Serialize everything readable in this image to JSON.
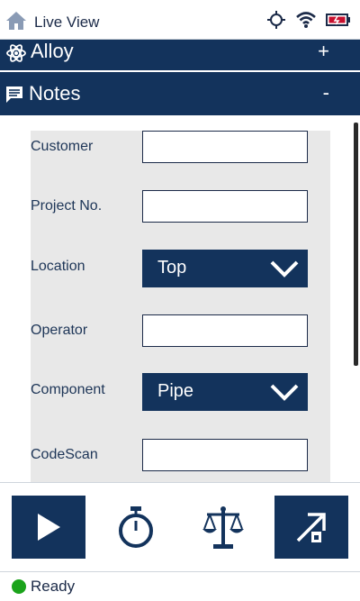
{
  "header": {
    "title": "Live View",
    "icons": [
      "home-icon",
      "gps-icon",
      "wifi-icon",
      "battery-icon"
    ]
  },
  "accordions": {
    "alloy": {
      "title": "Alloy",
      "toggle": "+",
      "icon": "atom-icon"
    },
    "notes": {
      "title": "Notes",
      "toggle": "-",
      "icon": "note-icon"
    }
  },
  "notes_form": {
    "customer": {
      "label": "Customer",
      "value": ""
    },
    "project": {
      "label": "Project No.",
      "value": ""
    },
    "location": {
      "label": "Location",
      "value": "Top"
    },
    "operator": {
      "label": "Operator",
      "value": ""
    },
    "component": {
      "label": "Component",
      "value": "Pipe"
    },
    "codescan": {
      "label": "CodeScan",
      "value": ""
    }
  },
  "toolbar": {
    "buttons": [
      "play-icon",
      "stopwatch-icon",
      "balance-scale-icon",
      "export-icon"
    ]
  },
  "status": {
    "text": "Ready",
    "color": "#1ba31b"
  },
  "colors": {
    "navy": "#13335c",
    "panel": "#e8e8e8",
    "text": "#1d3557"
  }
}
